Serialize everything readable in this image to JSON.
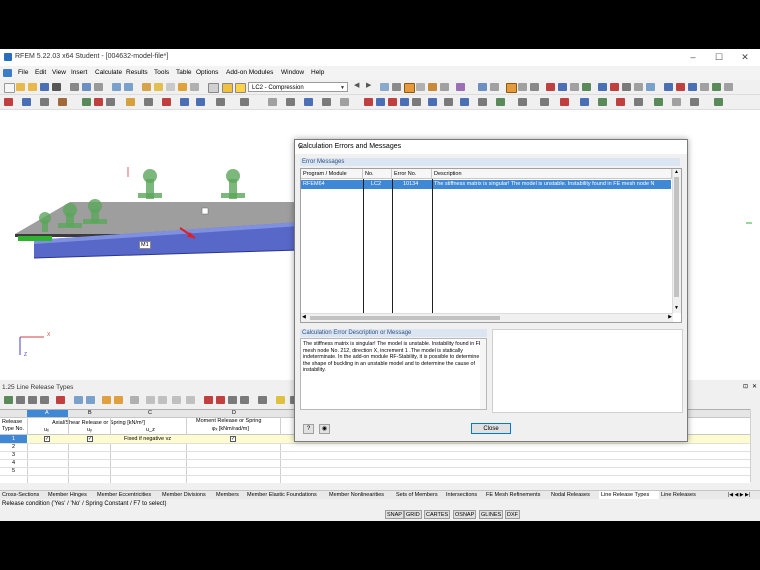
{
  "app": {
    "title": "RFEM 5.22.03 x64 Student - [004632-model-file*]",
    "window_buttons": [
      "–",
      "☐",
      "✕"
    ]
  },
  "menu": [
    "File",
    "Edit",
    "View",
    "Insert",
    "Calculate",
    "Results",
    "Tools",
    "Table",
    "Options",
    "Add-on Modules",
    "Window",
    "Help"
  ],
  "toolbar": {
    "load_case": "LC2 - Compression"
  },
  "viewport": {
    "member_label": "M1",
    "axis_x": "X",
    "axis_z": "Z"
  },
  "dialog": {
    "title": "Calculation Errors and Messages",
    "close_x": "✕",
    "errors_heading": "Error Messages",
    "columns": [
      "Program / Module",
      "No.",
      "Error No.",
      "Description"
    ],
    "rows": [
      {
        "program": "RFEM64",
        "no": "LC2",
        "error_no": "10134",
        "description": "The stiffness matrix is singular! The model is unstable. Instability found in FE mesh node N"
      }
    ],
    "desc_heading": "Calculation Error Description or Message",
    "desc_text": "The stiffness matrix is singular! The model is unstable. Instability found in FE mesh node No. 212, direction X, increment 1 .The model is statically indeterminate. In the add-on module RF-Stability, it is possible to determine the shape of buckling in an unstable model and to determine the cause of instability.",
    "close_button": "Close"
  },
  "panel": {
    "title": "1.25 Line Release Types",
    "col_letters": [
      "A",
      "B",
      "C",
      "D"
    ],
    "header_release": "Release",
    "header_typeno": "Type No.",
    "header_axial": "Axial/Shear Release or Spring [kN/m²]",
    "header_moment": "Moment Release or Spring",
    "sub_ux": "uₓ",
    "sub_uy": "uᵧ",
    "sub_uz": "u_z",
    "sub_phix": "φₓ [kNm/rad/m]",
    "rows": [
      "1",
      "2",
      "3",
      "4",
      "5"
    ],
    "row1_fixed": "Fixed if negative vz"
  },
  "tabs": [
    "Cross-Sections",
    "Member Hinges",
    "Member Eccentricities",
    "Member Divisions",
    "Members",
    "Member Elastic Foundations",
    "Member Nonlinearities",
    "Sets of Members",
    "Intersections",
    "FE Mesh Refinements",
    "Nodal Releases",
    "Line Release Types",
    "Line Releases"
  ],
  "status_text": "Release condition ('Yes' / 'No' / Spring Constant / F7 to select)",
  "snap_buttons": [
    "SNAP",
    "GRID",
    "CARTES",
    "OSNAP",
    "GLINES",
    "DXF"
  ]
}
